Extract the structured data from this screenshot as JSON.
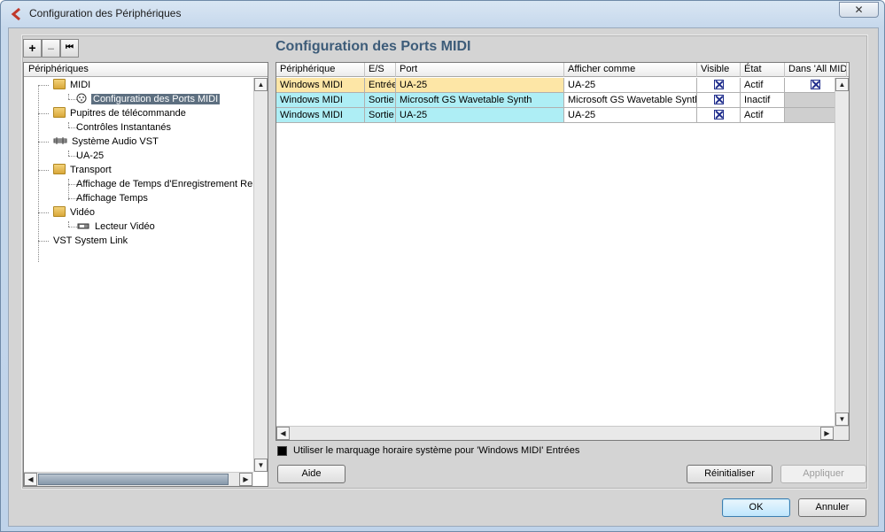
{
  "window": {
    "title": "Configuration des Périphériques"
  },
  "toolbar": {
    "add": "+",
    "remove": "–",
    "reset": "⏮"
  },
  "tree": {
    "header": "Périphériques",
    "items": [
      {
        "label": "MIDI"
      },
      {
        "label": "Configuration des Ports MIDI"
      },
      {
        "label": "Pupitres de télécommande"
      },
      {
        "label": "Contrôles Instantanés"
      },
      {
        "label": "Système Audio VST"
      },
      {
        "label": "UA-25"
      },
      {
        "label": "Transport"
      },
      {
        "label": "Affichage de Temps d'Enregistrement Restant"
      },
      {
        "label": "Affichage Temps"
      },
      {
        "label": "Vidéo"
      },
      {
        "label": "Lecteur Vidéo"
      },
      {
        "label": "VST System Link"
      }
    ]
  },
  "main": {
    "heading": "Configuration des Ports MIDI",
    "columns": [
      "Périphérique",
      "E/S",
      "Port",
      "Afficher comme",
      "Visible",
      "État",
      "Dans 'All MIDI'"
    ],
    "rows": [
      {
        "device": "Windows MIDI",
        "io": "Entrée",
        "port": "UA-25",
        "show_as": "UA-25",
        "visible": true,
        "state": "Actif",
        "all_midi": true,
        "color": "#fde6a6"
      },
      {
        "device": "Windows MIDI",
        "io": "Sortie",
        "port": "Microsoft GS Wavetable Synth",
        "show_as": "Microsoft GS Wavetable Synth",
        "visible": true,
        "state": "Inactif",
        "all_midi": null,
        "color": "#aeeef5"
      },
      {
        "device": "Windows MIDI",
        "io": "Sortie",
        "port": "UA-25",
        "show_as": "UA-25",
        "visible": true,
        "state": "Actif",
        "all_midi": null,
        "color": "#aeeef5"
      }
    ],
    "sync_label": "Utiliser le marquage horaire système pour 'Windows MIDI' Entrées"
  },
  "buttons": {
    "help": "Aide",
    "reset": "Réinitialiser",
    "apply": "Appliquer",
    "ok": "OK",
    "cancel": "Annuler"
  },
  "colors": {
    "heading": "#3d5c79",
    "selected": "#5d6f80",
    "input_row": "#fde6a6",
    "output_row": "#aeeef5",
    "disabled_cell": "#cfcfcf"
  }
}
